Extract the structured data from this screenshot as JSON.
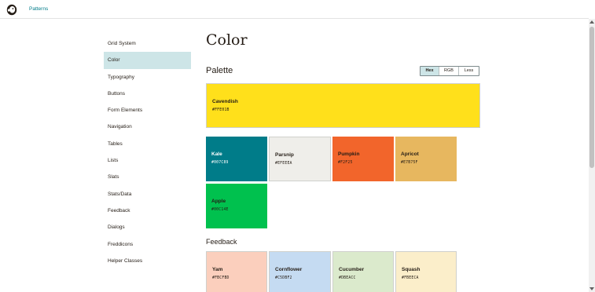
{
  "header": {
    "logo_icon": "freddie-logo-icon",
    "link": "Patterns"
  },
  "sidebar": {
    "items": [
      {
        "label": "Grid System"
      },
      {
        "label": "Color",
        "active": true
      },
      {
        "label": "Typography"
      },
      {
        "label": "Buttons"
      },
      {
        "label": "Form Elements"
      },
      {
        "label": "Navigation"
      },
      {
        "label": "Tables"
      },
      {
        "label": "Lists"
      },
      {
        "label": "Slats"
      },
      {
        "label": "Stats/Data"
      },
      {
        "label": "Feedback"
      },
      {
        "label": "Dialogs"
      },
      {
        "label": "Freddicons"
      },
      {
        "label": "Helper Classes"
      }
    ]
  },
  "main": {
    "title": "Color",
    "palette_heading": "Palette",
    "format_toggle": {
      "options": [
        "Hex",
        "RGB",
        "Less"
      ],
      "selected": "Hex"
    },
    "palette": [
      {
        "name": "Cavendish",
        "hex": "#FFE01B",
        "color": "#FFE01B",
        "text_color": "#241c15"
      },
      {
        "name": "Kale",
        "hex": "#007C89",
        "color": "#007C89",
        "text_color": "#ffffff"
      },
      {
        "name": "Parsnip",
        "hex": "#EFEEEA",
        "color": "#EFEEEA",
        "text_color": "#241c15"
      },
      {
        "name": "Pumpkin",
        "hex": "#F2F25",
        "color": "#F2652B",
        "text_color": "#241c15"
      },
      {
        "name": "Apricot",
        "hex": "#E7B75F",
        "color": "#E7B75F",
        "text_color": "#241c15"
      },
      {
        "name": "Apple",
        "hex": "#00C14E",
        "color": "#00C14E",
        "text_color": "#241c15"
      }
    ],
    "feedback_heading": "Feedback",
    "feedback": [
      {
        "name": "Yam",
        "hex": "#FBCFBD",
        "color": "#FBCFBD",
        "text_color": "#241c15"
      },
      {
        "name": "Cornflower",
        "hex": "#C5DBF2",
        "color": "#C5DBF2",
        "text_color": "#241c15"
      },
      {
        "name": "Cucumber",
        "hex": "#DBEACC",
        "color": "#DBEACC",
        "text_color": "#241c15"
      },
      {
        "name": "Squash",
        "hex": "#FBEECA",
        "color": "#FBEECA",
        "text_color": "#241c15"
      }
    ]
  }
}
